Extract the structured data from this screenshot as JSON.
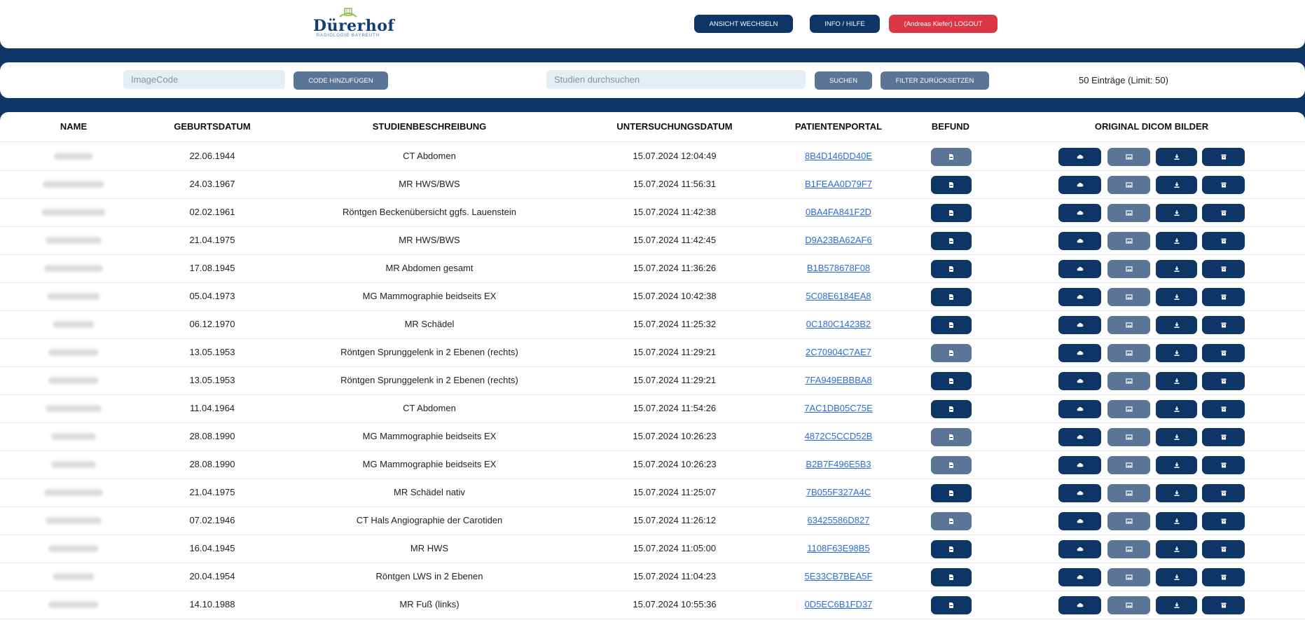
{
  "brand": {
    "name": "Dürerhof",
    "subtitle": "RADIOLOGIE BAYREUTH"
  },
  "header": {
    "switch_view": "ANSICHT WECHSELN",
    "info_help": "INFO / HILFE",
    "logout": "(Andreas Kiefer) LOGOUT"
  },
  "filter": {
    "imagecode_placeholder": "ImageCode",
    "add_code": "CODE HINZUFÜGEN",
    "search_placeholder": "Studien durchsuchen",
    "search": "SUCHEN",
    "reset": "FILTER ZURÜCKSETZEN",
    "count": "50 Einträge (Limit: 50)"
  },
  "columns": {
    "name": "NAME",
    "birthdate": "GEBURTSDATUM",
    "description": "STUDIENBESCHREIBUNG",
    "exam_date": "UNTERSUCHUNGSDATUM",
    "portal": "PATIENTENPORTAL",
    "report": "BEFUND",
    "dicom": "ORIGINAL DICOM BILDER"
  },
  "icons": {
    "report": "pdf-file-icon",
    "cloud": "cloud-icon",
    "viewer": "image-viewer-icon",
    "download": "download-icon",
    "archive": "archive-box-icon"
  },
  "colors": {
    "navy": "#0d3566",
    "slate": "#5a7596",
    "danger": "#dc3545",
    "link": "#2a6fd0"
  },
  "rows": [
    {
      "birthdate": "22.06.1944",
      "description": "CT Abdomen",
      "exam_date": "15.07.2024 12:04:49",
      "portal": "8B4D146DD40E",
      "report_state": "slate",
      "viewer_state": "slate"
    },
    {
      "birthdate": "24.03.1967",
      "description": "MR HWS/BWS",
      "exam_date": "15.07.2024 11:56:31",
      "portal": "B1FEAA0D79F7",
      "report_state": "navy",
      "viewer_state": "slate"
    },
    {
      "birthdate": "02.02.1961",
      "description": "Röntgen Beckenübersicht ggfs. Lauenstein",
      "exam_date": "15.07.2024 11:42:38",
      "portal": "0BA4FA841F2D",
      "report_state": "navy",
      "viewer_state": "slate"
    },
    {
      "birthdate": "21.04.1975",
      "description": "MR HWS/BWS",
      "exam_date": "15.07.2024 11:42:45",
      "portal": "D9A23BA62AF6",
      "report_state": "navy",
      "viewer_state": "slate"
    },
    {
      "birthdate": "17.08.1945",
      "description": "MR Abdomen gesamt",
      "exam_date": "15.07.2024 11:36:26",
      "portal": "B1B578678F08",
      "report_state": "navy",
      "viewer_state": "slate"
    },
    {
      "birthdate": "05.04.1973",
      "description": "MG Mammographie beidseits EX",
      "exam_date": "15.07.2024 10:42:38",
      "portal": "5C08E6184EA8",
      "report_state": "navy",
      "viewer_state": "slate"
    },
    {
      "birthdate": "06.12.1970",
      "description": "MR Schädel",
      "exam_date": "15.07.2024 11:25:32",
      "portal": "0C180C1423B2",
      "report_state": "navy",
      "viewer_state": "slate"
    },
    {
      "birthdate": "13.05.1953",
      "description": "Röntgen Sprunggelenk in 2 Ebenen (rechts)",
      "exam_date": "15.07.2024 11:29:21",
      "portal": "2C70904C7AE7",
      "report_state": "slate",
      "viewer_state": "slate"
    },
    {
      "birthdate": "13.05.1953",
      "description": "Röntgen Sprunggelenk in 2 Ebenen (rechts)",
      "exam_date": "15.07.2024 11:29:21",
      "portal": "7FA949EBBBA8",
      "report_state": "navy",
      "viewer_state": "slate"
    },
    {
      "birthdate": "11.04.1964",
      "description": "CT Abdomen",
      "exam_date": "15.07.2024 11:54:26",
      "portal": "7AC1DB05C75E",
      "report_state": "navy",
      "viewer_state": "slate"
    },
    {
      "birthdate": "28.08.1990",
      "description": "MG Mammographie beidseits EX",
      "exam_date": "15.07.2024 10:26:23",
      "portal": "4872C5CCD52B",
      "report_state": "slate",
      "viewer_state": "slate"
    },
    {
      "birthdate": "28.08.1990",
      "description": "MG Mammographie beidseits EX",
      "exam_date": "15.07.2024 10:26:23",
      "portal": "B2B7F496E5B3",
      "report_state": "slate",
      "viewer_state": "slate"
    },
    {
      "birthdate": "21.04.1975",
      "description": "MR Schädel nativ",
      "exam_date": "15.07.2024 11:25:07",
      "portal": "7B055F327A4C",
      "report_state": "navy",
      "viewer_state": "slate"
    },
    {
      "birthdate": "07.02.1946",
      "description": "CT Hals Angiographie der Carotiden",
      "exam_date": "15.07.2024 11:26:12",
      "portal": "63425586D827",
      "report_state": "slate",
      "viewer_state": "slate"
    },
    {
      "birthdate": "16.04.1945",
      "description": "MR HWS",
      "exam_date": "15.07.2024 11:05:00",
      "portal": "1108F63E98B5",
      "report_state": "navy",
      "viewer_state": "slate"
    },
    {
      "birthdate": "20.04.1954",
      "description": "Röntgen LWS in 2 Ebenen",
      "exam_date": "15.07.2024 11:04:23",
      "portal": "5E33CB7BEA5F",
      "report_state": "navy",
      "viewer_state": "slate"
    },
    {
      "birthdate": "14.10.1988",
      "description": "MR Fuß (links)",
      "exam_date": "15.07.2024 10:55:36",
      "portal": "0D5EC6B1FD37",
      "report_state": "navy",
      "viewer_state": "slate"
    }
  ]
}
